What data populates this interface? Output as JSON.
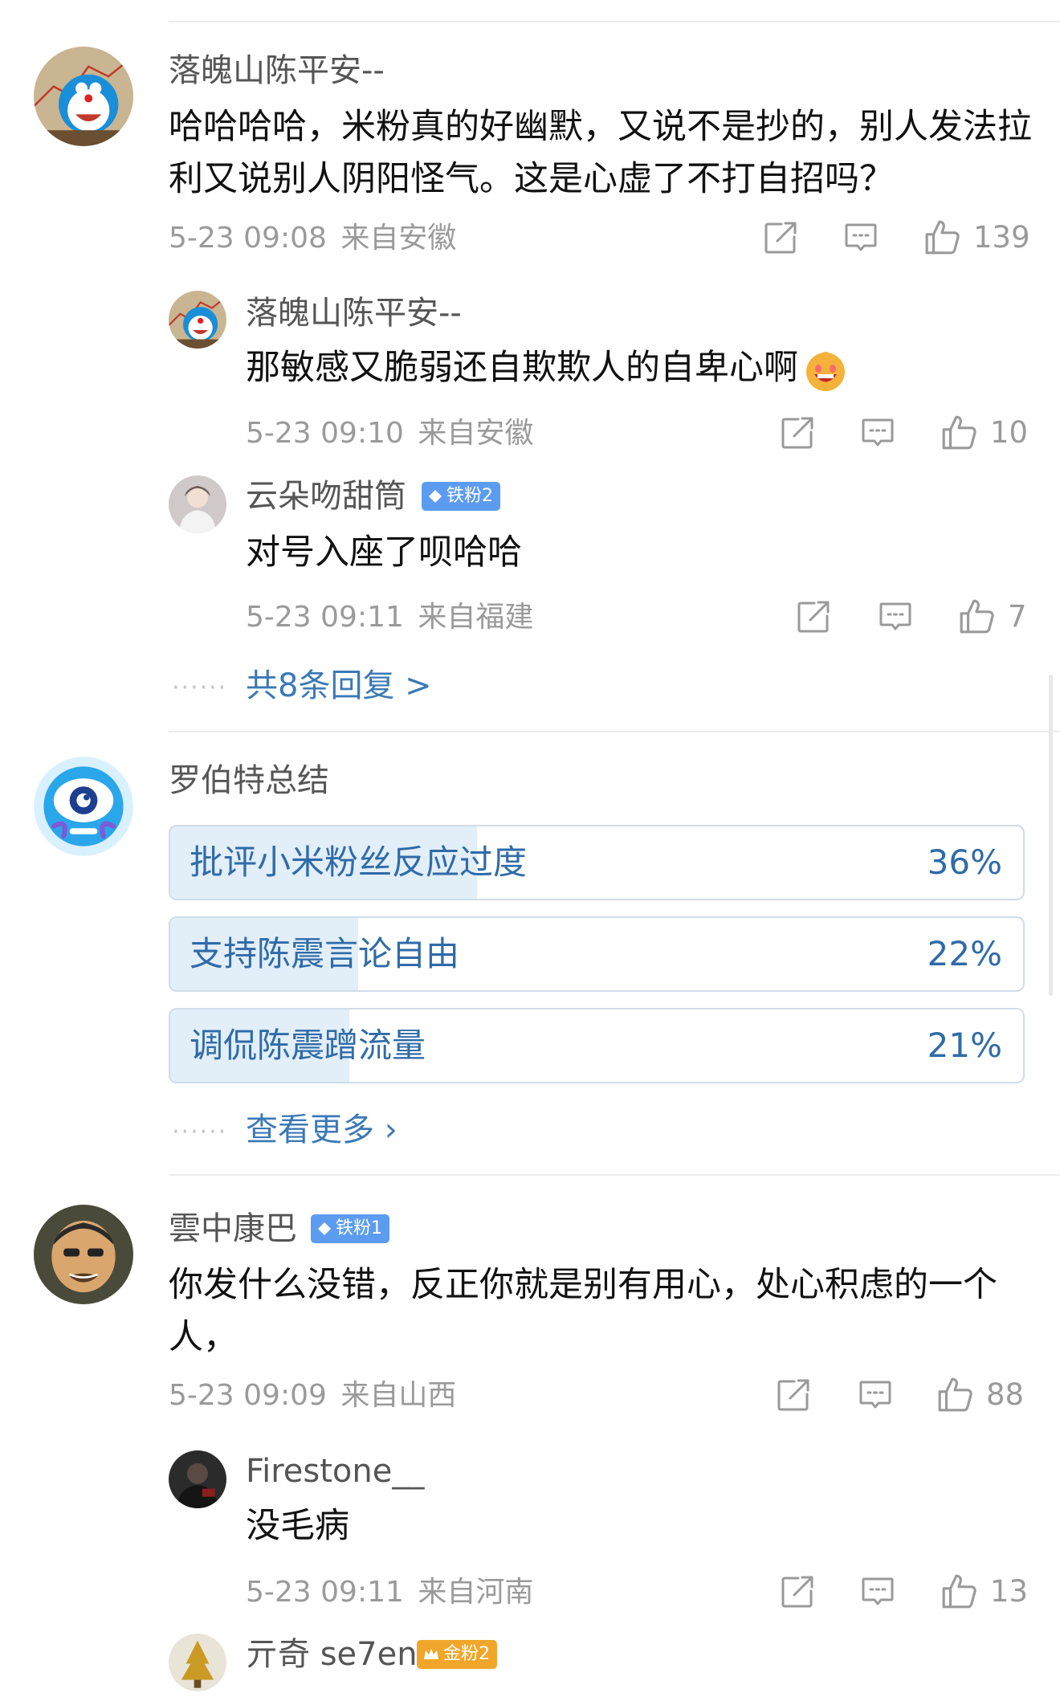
{
  "comments": [
    {
      "user": "落魄山陈平安--",
      "text": "哈哈哈哈，米粉真的好幽默，又说不是抄的，别人发法拉利又说别人阴阳怪气。这是心虚了不打自招吗？",
      "time": "5-23 09:08",
      "location": "来自安徽",
      "likes": "139",
      "replies": [
        {
          "user": "落魄山陈平安--",
          "text": "那敏感又脆弱还自欺欺人的自卑心啊",
          "time": "5-23 09:10",
          "location": "来自安徽",
          "likes": "10"
        },
        {
          "user": "云朵吻甜筒",
          "badge": "铁粉2",
          "text": "对号入座了呗哈哈",
          "time": "5-23 09:11",
          "location": "来自福建",
          "likes": "7"
        }
      ],
      "more_replies": "共8条回复 >"
    },
    {
      "user": "雲中康巴",
      "badge": "铁粉1",
      "text": "你发什么没错，反正你就是别有用心，处心积虑的一个人，",
      "time": "5-23 09:09",
      "location": "来自山西",
      "likes": "88",
      "replies": [
        {
          "user": "Firestone__",
          "text": "没毛病",
          "time": "5-23 09:11",
          "location": "来自河南",
          "likes": "13"
        },
        {
          "user": "亓奇 se7en",
          "badge": "金粉2"
        }
      ]
    }
  ],
  "poll": {
    "title": "罗伯特总结",
    "options": [
      {
        "label": "批评小米粉丝反应过度",
        "percent": "36%",
        "value": 0.36
      },
      {
        "label": "支持陈震言论自由",
        "percent": "22%",
        "value": 0.22
      },
      {
        "label": "调侃陈震蹭流量",
        "percent": "21%",
        "value": 0.21
      }
    ],
    "more": "查看更多 ›"
  },
  "icons": {
    "share": "share-icon",
    "comment": "comment-icon",
    "like": "like-icon",
    "badge": "diamond-icon",
    "gold_badge": "crown-icon",
    "emoji": "grinning-emoji-icon"
  },
  "colors": {
    "link": "#3b79b6",
    "poll_fill": "#e2eef8",
    "iron_badge": "#5c9cf0",
    "gold_badge": "#f0a62a"
  }
}
